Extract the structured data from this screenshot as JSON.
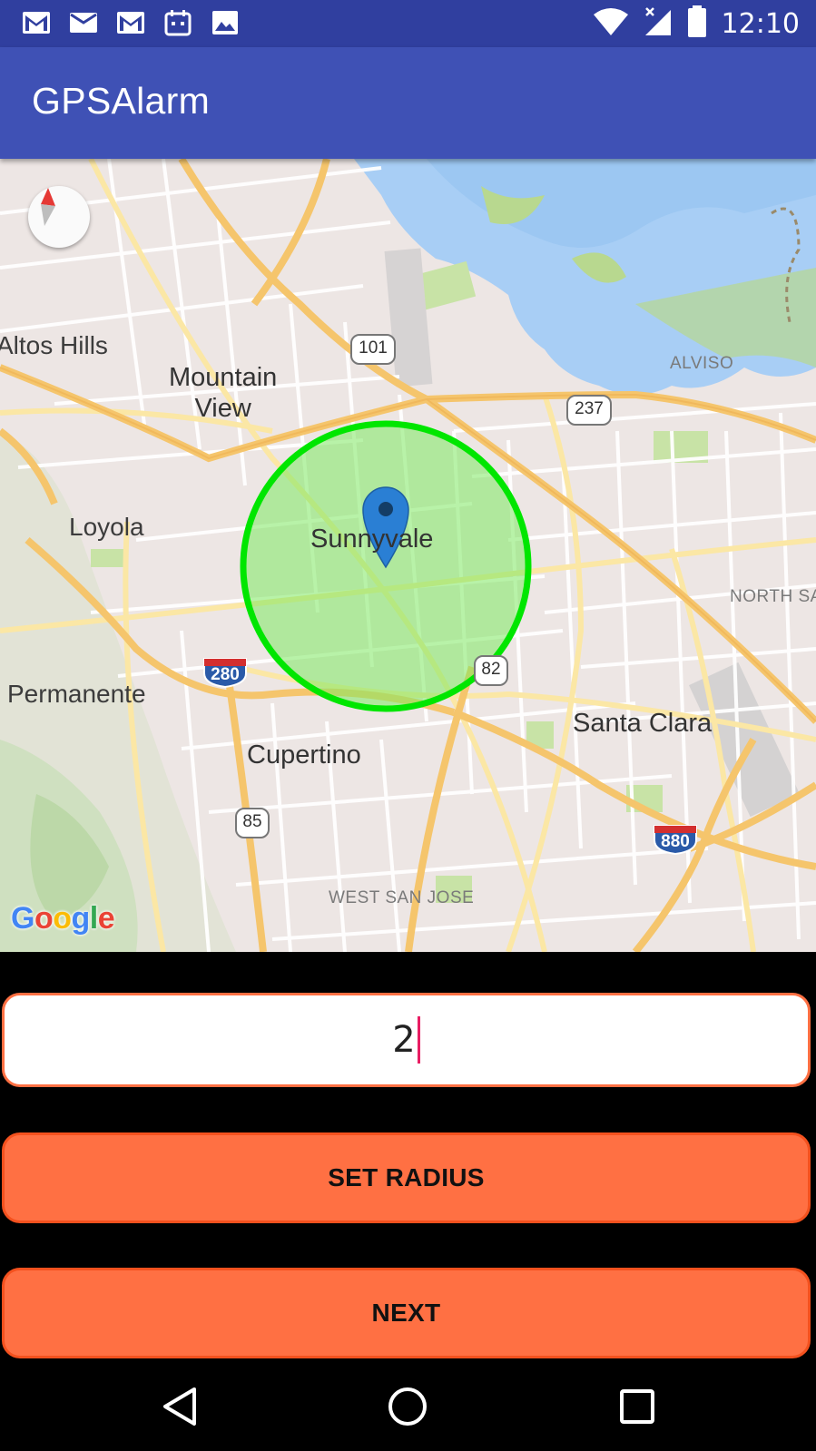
{
  "status_bar": {
    "time": "12:10",
    "left_icons": [
      "gmail-icon",
      "gmail-icon",
      "gmail-icon",
      "calendar-icon",
      "image-icon"
    ],
    "right_icons": [
      "wifi-icon",
      "cell-signal-icon",
      "battery-icon"
    ]
  },
  "app_bar": {
    "title": "GPSAlarm"
  },
  "map": {
    "labels": {
      "altos_hills": "Altos Hills",
      "mountain_view": "Mountain\nView",
      "loyola": "Loyola",
      "sunnyvale": "Sunnyvale",
      "permanente": "Permanente",
      "cupertino": "Cupertino",
      "santa_clara": "Santa Clara",
      "alviso": "ALVISO",
      "north_san": "NORTH SAN",
      "west_san_jose": "WEST SAN JOSE"
    },
    "shields": {
      "us101": "101",
      "ca237": "237",
      "i280": "280",
      "ca82": "82",
      "ca85": "85",
      "i880": "880"
    },
    "attribution": "Google",
    "geofence_color": "#00E600",
    "marker_color": "#2A7FD4"
  },
  "radius_field": {
    "value": "2"
  },
  "buttons": {
    "set_radius": "SET RADIUS",
    "next": "NEXT"
  },
  "colors": {
    "primary": "#3F51B5",
    "primary_dark": "#303F9F",
    "accent": "#FF7043",
    "cursor": "#E91E63"
  }
}
